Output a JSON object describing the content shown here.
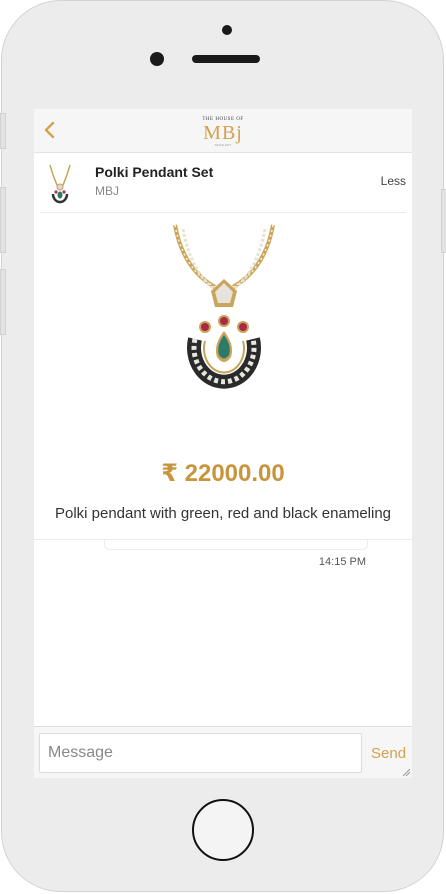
{
  "header": {
    "logo_top": "THE HOUSE OF",
    "logo_main": "MBj",
    "logo_since": "SINCE 1977"
  },
  "item": {
    "title": "Polki Pendant Set",
    "vendor": "MBJ",
    "toggle_label": "Less",
    "price": "₹ 22000.00",
    "description": "Polki pendant with green, red and black enameling"
  },
  "chat": {
    "timestamp": "14:15 PM"
  },
  "composer": {
    "placeholder": "Message",
    "send_label": "Send"
  },
  "colors": {
    "accent": "#d4a24e",
    "price": "#c8953c"
  },
  "icons": {
    "back": "chevron-left-icon",
    "home": "home-button"
  }
}
